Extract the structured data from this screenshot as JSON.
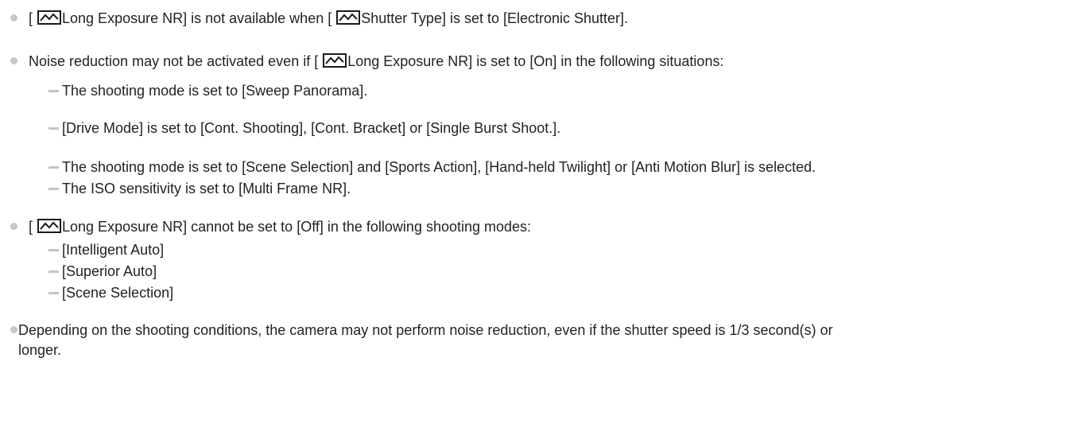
{
  "notes": [
    {
      "type": "bullet",
      "segments": [
        "[",
        "Long Exposure NR] is not available when [",
        "Shutter Type] is set to [Electronic Shutter]."
      ]
    },
    {
      "type": "bullet",
      "segments": [
        "Noise reduction may not be activated even if [",
        "Long Exposure NR] is set to [On] in the following situations:"
      ],
      "items": [
        "The shooting mode is set to [Sweep Panorama].",
        "[Drive Mode] is set to [Cont. Shooting], [Cont. Bracket] or [Single Burst Shoot.].",
        "The shooting mode is set to [Scene Selection] and [Sports Action], [Hand-held Twilight] or [Anti Motion Blur] is selected.",
        "The ISO sensitivity is set to [Multi Frame NR]."
      ]
    },
    {
      "type": "bullet",
      "segments": [
        "[",
        "Long Exposure NR] cannot be set to [Off] in the following shooting modes:"
      ],
      "items": [
        "[Intelligent Auto]",
        "[Superior Auto]",
        "[Scene Selection]"
      ]
    },
    {
      "type": "bullet",
      "lines": [
        "Depending on the shooting conditions, the camera may not perform noise reduction, even if the shutter speed is 1/3 second(s) or",
        "longer."
      ]
    }
  ],
  "icons": {
    "shooting_menu_icon": "camera-shooting-menu-icon",
    "icon_color": "#1a1a1a",
    "bullet_color": "#c7c7c7",
    "dash_color": "#c4c4c4"
  }
}
